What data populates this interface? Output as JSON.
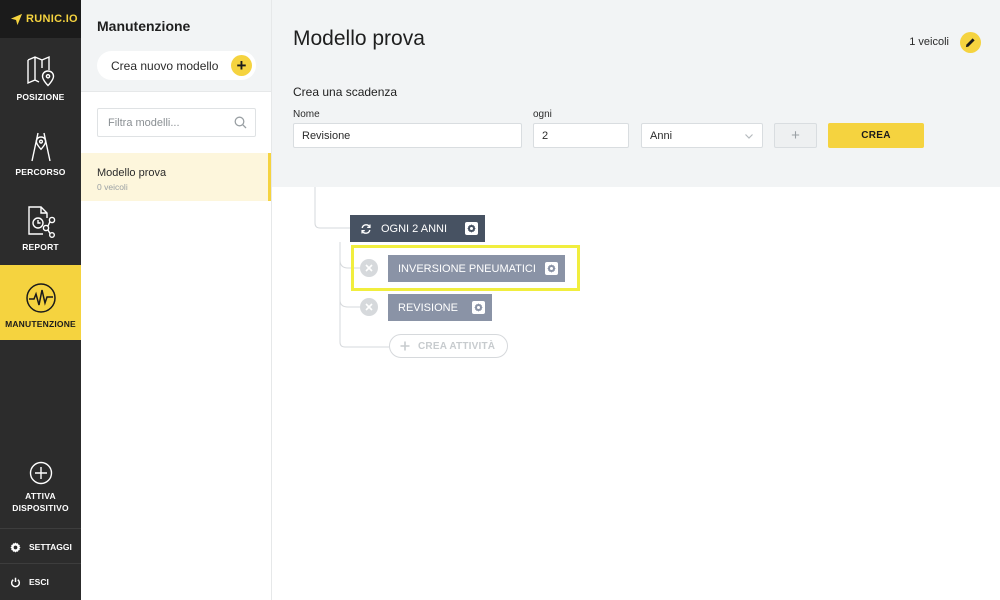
{
  "app": {
    "logo_text": "RUNIC.IO",
    "accent_color": "#f5d33f",
    "nav_bg": "#2c2c2c"
  },
  "nav": {
    "items": [
      {
        "label": "POSIZIONE",
        "icon": "map-pin-icon"
      },
      {
        "label": "PERCORSO",
        "icon": "route-icon"
      },
      {
        "label": "REPORT",
        "icon": "report-icon"
      },
      {
        "label": "MANUTENZIONE",
        "icon": "pulse-icon",
        "active": true
      }
    ],
    "activate_device": {
      "line1": "ATTIVA",
      "line2": "DISPOSITIVO",
      "icon": "add-circle-icon"
    },
    "settings": {
      "label": "SETTAGGI",
      "icon": "gear-icon"
    },
    "logout": {
      "label": "ESCI",
      "icon": "power-icon"
    }
  },
  "panel": {
    "title": "Manutenzione",
    "new_model_label": "Crea nuovo modello",
    "filter_placeholder": "Filtra modelli...",
    "models": [
      {
        "name": "Modello prova",
        "vehicles": "0 veicoli",
        "selected": true
      }
    ]
  },
  "main": {
    "title": "Modello prova",
    "vehicle_count": "1 veicoli",
    "form": {
      "section_title": "Crea una scadenza",
      "name_label": "Nome",
      "name_value": "Revisione",
      "every_label": "ogni",
      "every_value": "2",
      "unit_value": "Anni",
      "add_symbol": "+",
      "create_label": "CREA"
    },
    "tree": {
      "root": {
        "label": "OGNI 2 ANNI",
        "icon": "repeat-icon"
      },
      "tasks": [
        {
          "label": "INVERSIONE PNEUMATICI",
          "highlighted": true
        },
        {
          "label": "REVISIONE",
          "highlighted": false
        }
      ],
      "add_task_label": "CREA ATTIVITÀ"
    }
  }
}
